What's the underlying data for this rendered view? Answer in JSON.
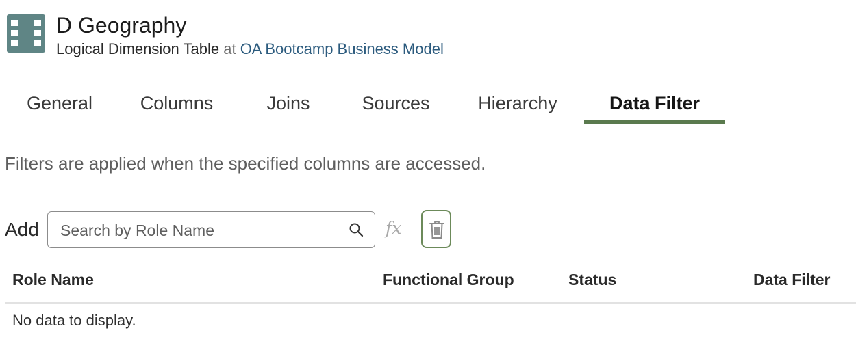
{
  "header": {
    "title": "D Geography",
    "kind": "Logical Dimension Table",
    "at": "at",
    "model_link": "OA Bootcamp Business Model",
    "icon": "logical-table-icon"
  },
  "tabs": [
    {
      "label": "General",
      "active": false
    },
    {
      "label": "Columns",
      "active": false
    },
    {
      "label": "Joins",
      "active": false
    },
    {
      "label": "Sources",
      "active": false
    },
    {
      "label": "Hierarchy",
      "active": false
    },
    {
      "label": "Data Filter",
      "active": true
    }
  ],
  "description": "Filters are applied when the specified columns are accessed.",
  "add_row": {
    "label": "Add",
    "search_placeholder": "Search by Role Name",
    "search_value": "",
    "fx_label": "fx"
  },
  "table": {
    "columns": [
      "Role Name",
      "Functional Group",
      "Status",
      "Data Filter"
    ],
    "rows": [],
    "empty_message": "No data to display."
  },
  "colors": {
    "accent": "#5a7a4e",
    "link": "#2c5b7e",
    "icon_fill": "#5f8585"
  }
}
